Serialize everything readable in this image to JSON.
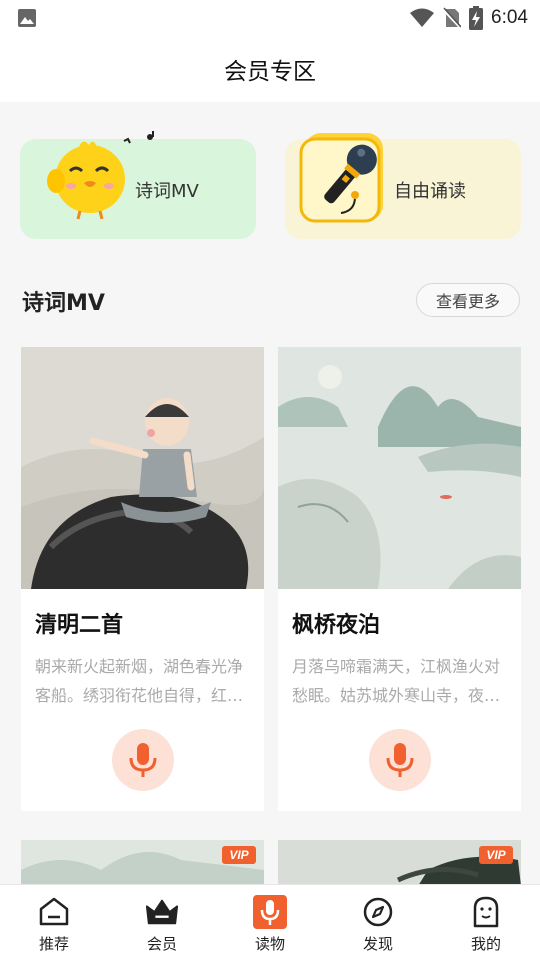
{
  "status_bar": {
    "time": "6:04",
    "icons": [
      "image-icon",
      "wifi-icon",
      "no-sim-icon",
      "battery-charging-icon"
    ]
  },
  "header": {
    "title": "会员专区"
  },
  "features": [
    {
      "label": "诗词MV",
      "icon": "cartoon-chick-icon",
      "bg": "#d9f5dc"
    },
    {
      "label": "自由诵读",
      "icon": "microphone-icon",
      "bg": "#f9f4d6"
    }
  ],
  "section": {
    "title": "诗词MV",
    "more_label": "查看更多"
  },
  "cards": [
    {
      "title": "清明二首",
      "desc": "朝来新火起新烟，湖色春光净客船。绣羽衔花他自得，红…",
      "image": "ink-painting-boy-on-buffalo"
    },
    {
      "title": "枫桥夜泊",
      "desc": "月落乌啼霜满天，江枫渔火对愁眠。姑苏城外寒山寺，夜…",
      "image": "ink-painting-river-mountains"
    }
  ],
  "next_cards": [
    {
      "badge": "VIP"
    },
    {
      "badge": "VIP"
    }
  ],
  "colors": {
    "accent": "#f0612f",
    "mic_bg": "#fde0d6",
    "vip": "#f0612f"
  },
  "tabs": [
    {
      "label": "推荐",
      "icon": "home-icon",
      "active": false
    },
    {
      "label": "会员",
      "icon": "crown-icon",
      "active": false
    },
    {
      "label": "读物",
      "icon": "microphone-icon",
      "active": true
    },
    {
      "label": "发现",
      "icon": "compass-icon",
      "active": false
    },
    {
      "label": "我的",
      "icon": "profile-icon",
      "active": false
    }
  ]
}
